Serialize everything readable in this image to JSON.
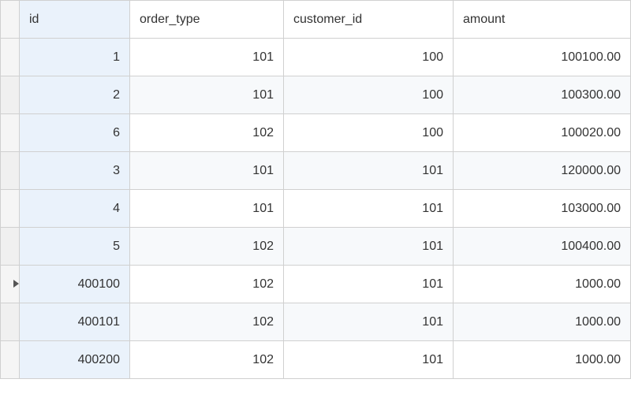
{
  "table": {
    "columns": {
      "id": "id",
      "order_type": "order_type",
      "customer_id": "customer_id",
      "amount": "amount"
    },
    "rows": [
      {
        "id": "1",
        "order_type": "101",
        "customer_id": "100",
        "amount": "100100.00",
        "active": false
      },
      {
        "id": "2",
        "order_type": "101",
        "customer_id": "100",
        "amount": "100300.00",
        "active": false
      },
      {
        "id": "6",
        "order_type": "102",
        "customer_id": "100",
        "amount": "100020.00",
        "active": false
      },
      {
        "id": "3",
        "order_type": "101",
        "customer_id": "101",
        "amount": "120000.00",
        "active": false
      },
      {
        "id": "4",
        "order_type": "101",
        "customer_id": "101",
        "amount": "103000.00",
        "active": false
      },
      {
        "id": "5",
        "order_type": "102",
        "customer_id": "101",
        "amount": "100400.00",
        "active": false
      },
      {
        "id": "400100",
        "order_type": "102",
        "customer_id": "101",
        "amount": "1000.00",
        "active": true
      },
      {
        "id": "400101",
        "order_type": "102",
        "customer_id": "101",
        "amount": "1000.00",
        "active": false
      },
      {
        "id": "400200",
        "order_type": "102",
        "customer_id": "101",
        "amount": "1000.00",
        "active": false
      }
    ]
  }
}
